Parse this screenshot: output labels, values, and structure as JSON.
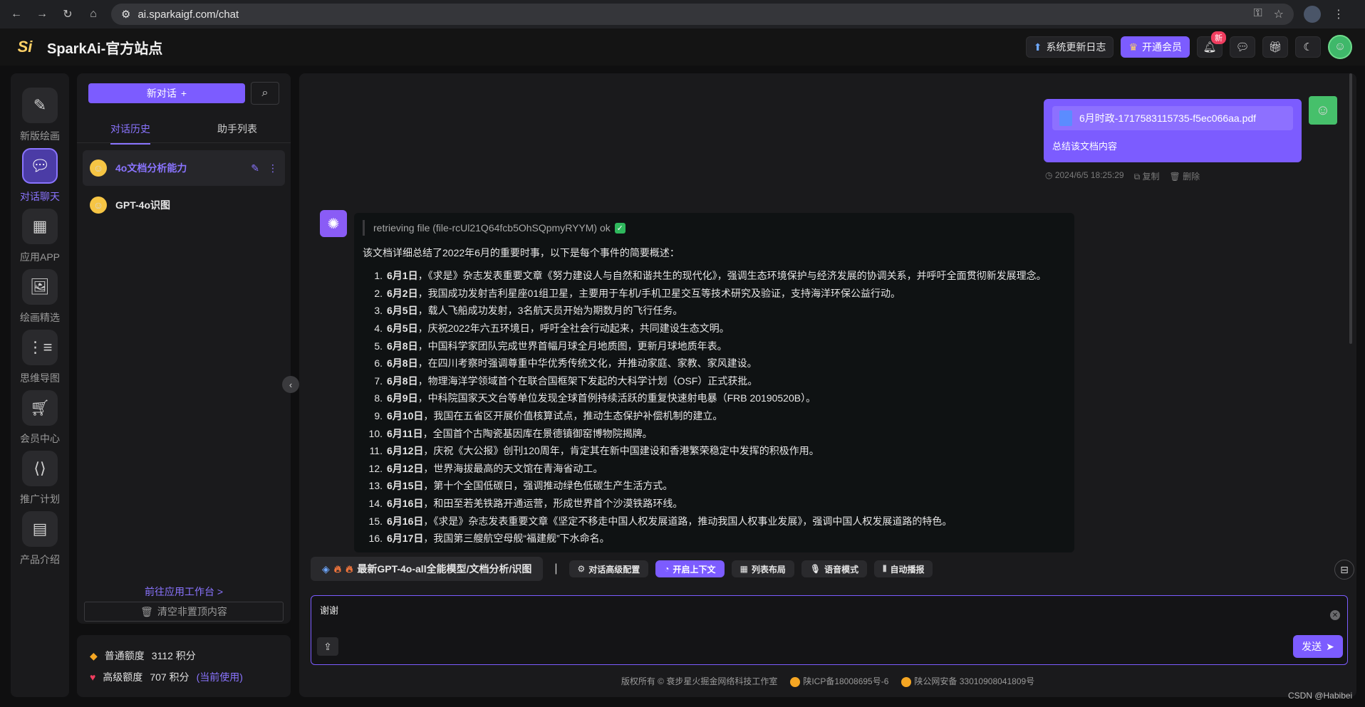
{
  "browser": {
    "url": "ai.sparkaigf.com/chat"
  },
  "header": {
    "logo_text": "Si",
    "title": "SparkAi-官方站点",
    "update_log": "系统更新日志",
    "vip": "开通会员",
    "notify_badge": "新"
  },
  "rail": {
    "items": [
      {
        "label": "新版绘画",
        "icon": "pen-brush-icon"
      },
      {
        "label": "对话聊天",
        "icon": "chat-bubble-icon"
      },
      {
        "label": "应用APP",
        "icon": "grid-apps-icon"
      },
      {
        "label": "绘画精选",
        "icon": "gallery-icon"
      },
      {
        "label": "思维导图",
        "icon": "mindmap-icon"
      },
      {
        "label": "会员中心",
        "icon": "cart-icon"
      },
      {
        "label": "推广计划",
        "icon": "share-icon"
      },
      {
        "label": "产品介绍",
        "icon": "archive-icon"
      }
    ]
  },
  "conversations": {
    "new_chat": "新对话",
    "tabs": [
      "对话历史",
      "助手列表"
    ],
    "items": [
      {
        "title": "4o文档分析能力"
      },
      {
        "title": "GPT-4o识图"
      }
    ],
    "workbench_link": "前往应用工作台 >",
    "clear_label": "清空非置顶内容"
  },
  "credits": {
    "normal_label": "普通额度",
    "normal_value": "3112 积分",
    "premium_label": "高级额度",
    "premium_value": "707 积分",
    "premium_link": "(当前使用)"
  },
  "chat": {
    "user_message": {
      "file_name": "6月时政-1717583115735-f5ec066aa.pdf",
      "text": "总结该文档内容",
      "time": "2024/6/5 18:25:29",
      "copy": "复制",
      "delete": "删除"
    },
    "bot_message": {
      "retrieve": "retrieving file (file-rcUl21Q64fcb5OhSQpmyRYYM) ok",
      "intro": "该文档详细总结了2022年6月的重要时事，以下是每个事件的简要概述：",
      "events": [
        {
          "num": "1.",
          "date": "6月1日",
          "text": "，《求是》杂志发表重要文章《努力建设人与自然和谐共生的现代化》，强调生态环境保护与经济发展的协调关系，并呼吁全面贯彻新发展理念。"
        },
        {
          "num": "2.",
          "date": "6月2日",
          "text": "，我国成功发射吉利星座01组卫星，主要用于车机/手机卫星交互等技术研究及验证，支持海洋环保公益行动。"
        },
        {
          "num": "3.",
          "date": "6月5日",
          "text": "，载人飞船成功发射，3名航天员开始为期数月的飞行任务。"
        },
        {
          "num": "4.",
          "date": "6月5日",
          "text": "，庆祝2022年六五环境日，呼吁全社会行动起来，共同建设生态文明。"
        },
        {
          "num": "5.",
          "date": "6月8日",
          "text": "，中国科学家团队完成世界首幅月球全月地质图，更新月球地质年表。"
        },
        {
          "num": "6.",
          "date": "6月8日",
          "text": "，在四川考察时强调尊重中华优秀传统文化，并推动家庭、家教、家风建设。"
        },
        {
          "num": "7.",
          "date": "6月8日",
          "text": "，物理海洋学领域首个在联合国框架下发起的大科学计划（OSF）正式获批。"
        },
        {
          "num": "8.",
          "date": "6月9日",
          "text": "，中科院国家天文台等单位发现全球首例持续活跃的重复快速射电暴（FRB 20190520B）。"
        },
        {
          "num": "9.",
          "date": "6月10日",
          "text": "，我国在五省区开展价值核算试点，推动生态保护补偿机制的建立。"
        },
        {
          "num": "10.",
          "date": "6月11日",
          "text": "，全国首个古陶瓷基因库在景德镇御窑博物院揭牌。"
        },
        {
          "num": "11.",
          "date": "6月12日",
          "text": "，庆祝《大公报》创刊120周年，肯定其在新中国建设和香港繁荣稳定中发挥的积极作用。"
        },
        {
          "num": "12.",
          "date": "6月12日",
          "text": "，世界海拔最高的天文馆在青海省动工。"
        },
        {
          "num": "13.",
          "date": "6月15日",
          "text": "，第十个全国低碳日，强调推动绿色低碳生产生活方式。"
        },
        {
          "num": "14.",
          "date": "6月16日",
          "text": "，和田至若羌铁路开通运营，形成世界首个沙漠铁路环线。"
        },
        {
          "num": "15.",
          "date": "6月16日",
          "text": "，《求是》杂志发表重要文章《坚定不移走中国人权发展道路，推动我国人权事业发展》，强调中国人权发展道路的特色。"
        },
        {
          "num": "16.",
          "date": "6月17日",
          "text": "，我国第三艘航空母舰“福建舰”下水命名。"
        }
      ]
    }
  },
  "toolbar": {
    "model": "最新GPT-4o-all全能模型/文档分析/识图",
    "divider": "|",
    "buttons": [
      {
        "label": "对话高级配置",
        "icon": "gear-icon",
        "active": false
      },
      {
        "label": "开启上下文",
        "icon": "chat-icon",
        "active": true
      },
      {
        "label": "列表布局",
        "icon": "list-layout-icon",
        "active": false
      },
      {
        "label": "语音模式",
        "icon": "mic-icon",
        "active": false
      },
      {
        "label": "自动播报",
        "icon": "audio-wave-icon",
        "active": false
      }
    ]
  },
  "input": {
    "value": "谢谢",
    "send": "发送"
  },
  "footer": {
    "copyright": "版权所有 © 衰步星火掘金网络科技工作室",
    "icp": "陕ICP备18008695号-6",
    "police": "陕公网安备 33010908041809号"
  },
  "watermark": "CSDN @Habibei",
  "colors": {
    "accent": "#7c5cff",
    "background": "#0f0f10",
    "panel": "#1a1a1c"
  }
}
